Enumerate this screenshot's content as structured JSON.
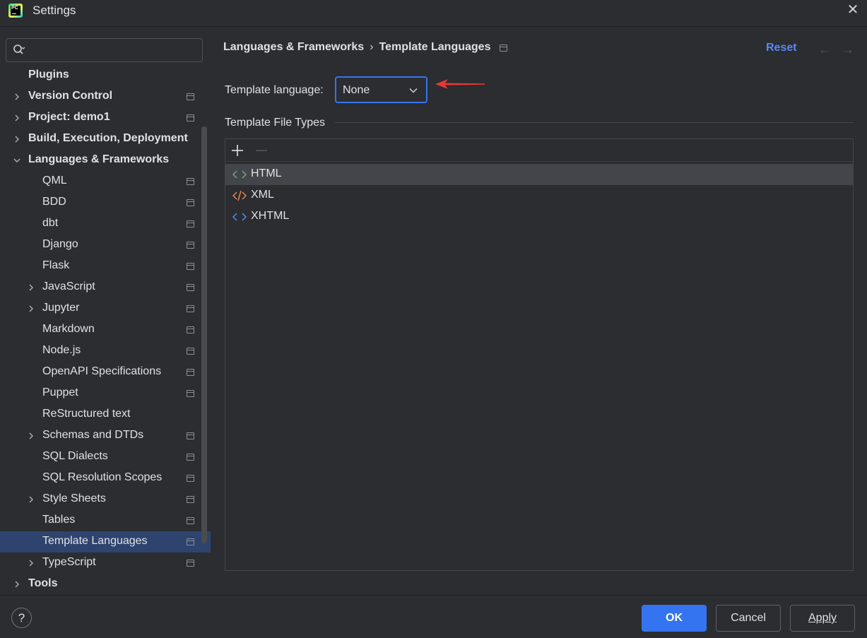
{
  "window": {
    "title": "Settings"
  },
  "search": {
    "placeholder": ""
  },
  "sidebar": {
    "items": [
      {
        "label": "Plugins",
        "bold": true,
        "level": 0,
        "expander": "none",
        "pin": false,
        "selected": false
      },
      {
        "label": "Version Control",
        "bold": true,
        "level": 0,
        "expander": "collapsed",
        "pin": true,
        "selected": false
      },
      {
        "label": "Project: demo1",
        "bold": true,
        "level": 0,
        "expander": "collapsed",
        "pin": true,
        "selected": false
      },
      {
        "label": "Build, Execution, Deployment",
        "bold": true,
        "level": 0,
        "expander": "collapsed",
        "pin": false,
        "selected": false
      },
      {
        "label": "Languages & Frameworks",
        "bold": true,
        "level": 0,
        "expander": "expanded",
        "pin": false,
        "selected": false
      },
      {
        "label": "QML",
        "bold": false,
        "level": 1,
        "expander": "none",
        "pin": true,
        "selected": false
      },
      {
        "label": "BDD",
        "bold": false,
        "level": 1,
        "expander": "none",
        "pin": true,
        "selected": false
      },
      {
        "label": "dbt",
        "bold": false,
        "level": 1,
        "expander": "none",
        "pin": true,
        "selected": false
      },
      {
        "label": "Django",
        "bold": false,
        "level": 1,
        "expander": "none",
        "pin": true,
        "selected": false
      },
      {
        "label": "Flask",
        "bold": false,
        "level": 1,
        "expander": "none",
        "pin": true,
        "selected": false
      },
      {
        "label": "JavaScript",
        "bold": false,
        "level": 1,
        "expander": "collapsed",
        "pin": true,
        "selected": false
      },
      {
        "label": "Jupyter",
        "bold": false,
        "level": 1,
        "expander": "collapsed",
        "pin": true,
        "selected": false
      },
      {
        "label": "Markdown",
        "bold": false,
        "level": 1,
        "expander": "none",
        "pin": true,
        "selected": false
      },
      {
        "label": "Node.js",
        "bold": false,
        "level": 1,
        "expander": "none",
        "pin": true,
        "selected": false
      },
      {
        "label": "OpenAPI Specifications",
        "bold": false,
        "level": 1,
        "expander": "none",
        "pin": true,
        "selected": false
      },
      {
        "label": "Puppet",
        "bold": false,
        "level": 1,
        "expander": "none",
        "pin": true,
        "selected": false
      },
      {
        "label": "ReStructured text",
        "bold": false,
        "level": 1,
        "expander": "none",
        "pin": false,
        "selected": false
      },
      {
        "label": "Schemas and DTDs",
        "bold": false,
        "level": 1,
        "expander": "collapsed",
        "pin": true,
        "selected": false
      },
      {
        "label": "SQL Dialects",
        "bold": false,
        "level": 1,
        "expander": "none",
        "pin": true,
        "selected": false
      },
      {
        "label": "SQL Resolution Scopes",
        "bold": false,
        "level": 1,
        "expander": "none",
        "pin": true,
        "selected": false
      },
      {
        "label": "Style Sheets",
        "bold": false,
        "level": 1,
        "expander": "collapsed",
        "pin": true,
        "selected": false
      },
      {
        "label": "Tables",
        "bold": false,
        "level": 1,
        "expander": "none",
        "pin": true,
        "selected": false
      },
      {
        "label": "Template Languages",
        "bold": false,
        "level": 1,
        "expander": "none",
        "pin": true,
        "selected": true
      },
      {
        "label": "TypeScript",
        "bold": false,
        "level": 1,
        "expander": "collapsed",
        "pin": true,
        "selected": false
      },
      {
        "label": "Tools",
        "bold": true,
        "level": 0,
        "expander": "collapsed",
        "pin": false,
        "selected": false
      }
    ]
  },
  "header": {
    "breadcrumb_parent": "Languages & Frameworks",
    "breadcrumb_separator": "›",
    "breadcrumb_current": "Template Languages",
    "reset_label": "Reset",
    "back_icon": "arrow-left-icon",
    "forward_icon": "arrow-right-icon"
  },
  "template_language": {
    "label": "Template language:",
    "value": "None"
  },
  "file_types": {
    "title": "Template File Types",
    "items": [
      {
        "label": "HTML",
        "icon": "html-icon",
        "color": "#6aab73",
        "selected": true
      },
      {
        "label": "XML",
        "icon": "xml-icon",
        "color": "#e08855",
        "selected": false
      },
      {
        "label": "XHTML",
        "icon": "xhtml-icon",
        "color": "#548af7",
        "selected": false
      }
    ]
  },
  "footer": {
    "help_label": "?",
    "ok_label": "OK",
    "cancel_label": "Cancel",
    "apply_label": "Apply"
  },
  "colors": {
    "background": "#2b2d30",
    "accent": "#3574f0",
    "selection": "#2e436e",
    "link": "#548af7",
    "annotation_arrow": "#e53935"
  }
}
